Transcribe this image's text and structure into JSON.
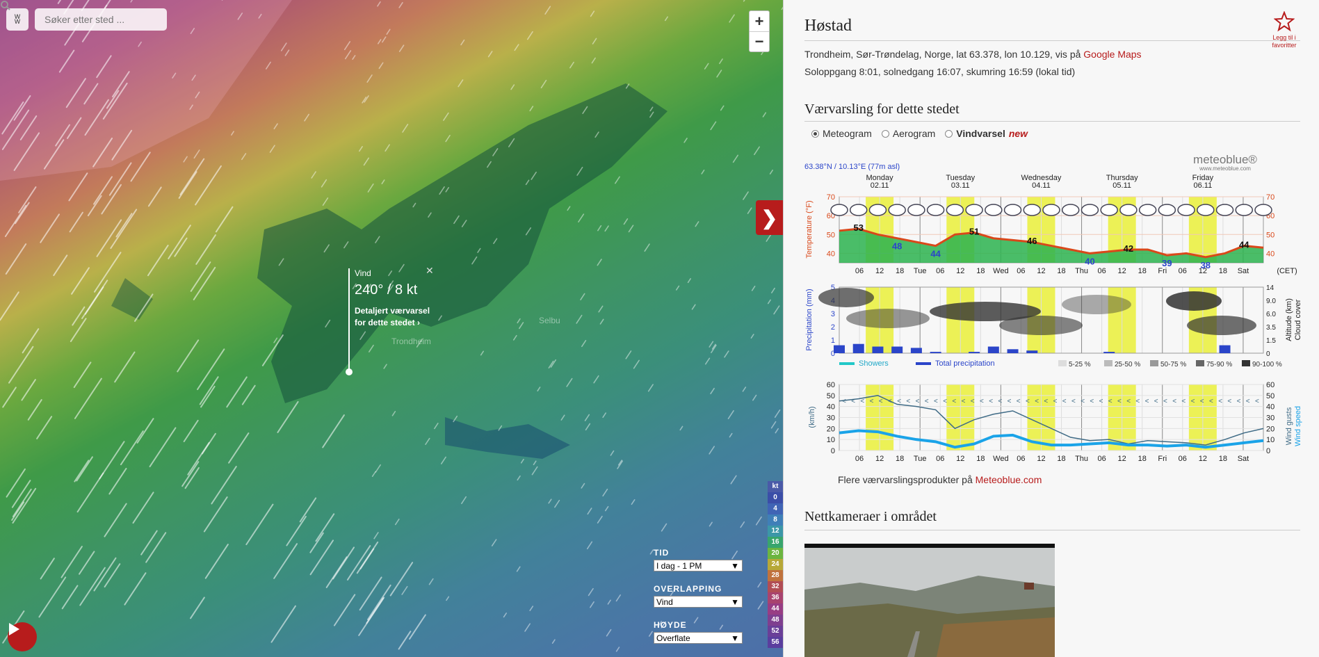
{
  "map": {
    "search_placeholder": "Søker etter sted ...",
    "zoom_in": "+",
    "zoom_out": "−",
    "popup": {
      "label": "Vind",
      "value": "240° / 8 kt",
      "link_line1": "Detaljert værvarsel",
      "link_line2": "for dette stedet"
    },
    "place_labels": [
      "Trondheim",
      "Selbu"
    ],
    "legend": {
      "unit": "kt",
      "items": [
        {
          "v": "0",
          "c": "#3b4ea8"
        },
        {
          "v": "4",
          "c": "#4064b5"
        },
        {
          "v": "8",
          "c": "#3f7fb8"
        },
        {
          "v": "12",
          "c": "#3c97a8"
        },
        {
          "v": "16",
          "c": "#38a56d"
        },
        {
          "v": "20",
          "c": "#6cb540"
        },
        {
          "v": "24",
          "c": "#b7a838"
        },
        {
          "v": "28",
          "c": "#c0723d"
        },
        {
          "v": "32",
          "c": "#b14d55"
        },
        {
          "v": "36",
          "c": "#a8436f"
        },
        {
          "v": "44",
          "c": "#983d84"
        },
        {
          "v": "48",
          "c": "#7f3f8f"
        },
        {
          "v": "52",
          "c": "#6a3f98"
        },
        {
          "v": "56",
          "c": "#5a3e9e"
        }
      ]
    },
    "controls": [
      {
        "title": "TID",
        "value": "I dag - 1 PM"
      },
      {
        "title": "OVERLAPPING",
        "value": "Vind"
      },
      {
        "title": "HØYDE",
        "value": "Overflate"
      }
    ]
  },
  "panel": {
    "title": "Høstad",
    "favorite": "Legg til i favoritter",
    "location_text": "Trondheim, Sør-Trøndelag, Norge, lat 63.378, lon 10.129, vis på",
    "google_maps": "Google Maps",
    "sun_text": "Soloppgang 8:01, solnedgang 16:07, skumring 16:59 (lokal tid)",
    "forecast_heading": "Værvarsling for dette stedet",
    "radios": [
      {
        "label": "Meteogram",
        "checked": true,
        "bold": false
      },
      {
        "label": "Aerogram",
        "checked": false,
        "bold": false
      },
      {
        "label": "Vindvarsel",
        "checked": false,
        "bold": true,
        "badge": "new"
      }
    ],
    "more_text": "Flere værvarslingsprodukter på",
    "more_link": "Meteoblue.com",
    "webcam_heading": "Nettkameraer i området"
  },
  "chart_data": {
    "type": "line",
    "title": "63.38°N / 10.13°E (77m asl)",
    "brand": "meteoblue®",
    "brand_sub": "www.meteoblue.com",
    "days": [
      {
        "name": "Monday",
        "date": "02.11"
      },
      {
        "name": "Tuesday",
        "date": "03.11"
      },
      {
        "name": "Wednesday",
        "date": "04.11"
      },
      {
        "name": "Thursday",
        "date": "05.11"
      },
      {
        "name": "Friday",
        "date": "06.11"
      }
    ],
    "x_tick_labels": [
      "06",
      "12",
      "18",
      "Tue",
      "06",
      "12",
      "18",
      "Wed",
      "06",
      "12",
      "18",
      "Thu",
      "06",
      "12",
      "18",
      "Fri",
      "06",
      "12",
      "18",
      "Sat"
    ],
    "timezone": "(CET)",
    "temperature": {
      "ylabel": "Temperature (°F)",
      "ylim": [
        35,
        70
      ],
      "yticks": [
        40,
        50,
        60,
        70
      ],
      "series": [
        {
          "values": [
            52,
            53,
            50,
            48,
            46,
            44,
            50,
            51,
            48,
            47,
            46,
            44,
            42,
            40,
            41,
            42,
            42,
            39,
            40,
            38,
            40,
            44,
            43
          ]
        }
      ],
      "labels": [
        {
          "i": 1,
          "t": "53",
          "hi": true
        },
        {
          "i": 3,
          "t": "48",
          "hi": false
        },
        {
          "i": 5,
          "t": "44",
          "hi": false
        },
        {
          "i": 7,
          "t": "51",
          "hi": true
        },
        {
          "i": 10,
          "t": "46",
          "hi": true
        },
        {
          "i": 13,
          "t": "40",
          "hi": false
        },
        {
          "i": 15,
          "t": "42",
          "hi": true
        },
        {
          "i": 17,
          "t": "39",
          "hi": false
        },
        {
          "i": 19,
          "t": "38",
          "hi": false
        },
        {
          "i": 21,
          "t": "44",
          "hi": true
        }
      ]
    },
    "precipitation": {
      "ylabel": "Precipitation (mm)",
      "yticks": [
        0,
        1,
        2,
        3,
        4,
        5
      ],
      "right_ticks": [
        "14",
        "9.0",
        "6.0",
        "3.5",
        "1.5",
        "0"
      ],
      "right_label": "Altitude (km)",
      "right_label2": "Cloud cover",
      "legend": [
        "Showers",
        "Total precipitation"
      ],
      "cloud_legend": [
        "5-25 %",
        "25-50 %",
        "50-75 %",
        "75-90 %",
        "90-100 %"
      ],
      "total": [
        0.6,
        0.7,
        0.5,
        0.5,
        0.4,
        0.1,
        0.0,
        0.1,
        0.5,
        0.3,
        0.2,
        0.0,
        0.0,
        0.0,
        0.1,
        0.0,
        0.0,
        0.0,
        0.0,
        0.0,
        0.6,
        0.0,
        0.0
      ]
    },
    "wind": {
      "ylabel": "(km/h)",
      "yticks": [
        0,
        10,
        20,
        30,
        40,
        50,
        60
      ],
      "right_label": "Wind gusts",
      "right_label2": "Wind speed",
      "ylim": [
        0,
        60
      ],
      "series": [
        {
          "name": "Wind gusts",
          "values": [
            45,
            47,
            50,
            42,
            40,
            37,
            20,
            28,
            33,
            36,
            28,
            20,
            12,
            9,
            10,
            6,
            9,
            8,
            7,
            5,
            10,
            16,
            20
          ]
        },
        {
          "name": "Wind speed",
          "values": [
            16,
            18,
            17,
            13,
            10,
            8,
            3,
            6,
            13,
            14,
            8,
            5,
            5,
            6,
            7,
            5,
            5,
            4,
            5,
            3,
            5,
            7,
            9
          ]
        }
      ]
    },
    "colors": {
      "temp_line": "#d9481a",
      "temp_fill": "#2bb34f",
      "highlight": "#eaf03a",
      "wind_speed": "#1aa3e8",
      "wind_gusts": "#3f6b86",
      "precip": "#2b45c9"
    }
  }
}
